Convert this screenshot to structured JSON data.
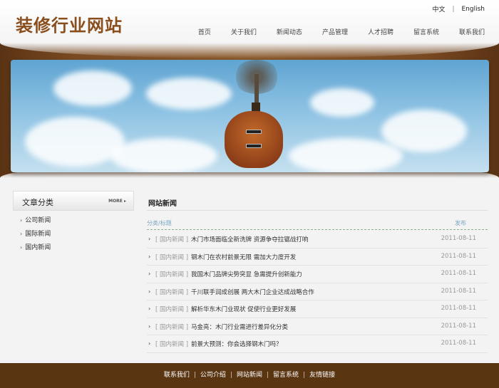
{
  "header": {
    "logo": "装修行业网站",
    "lang": [
      "中文",
      "English"
    ],
    "lang_sep": "|",
    "nav": [
      "首页",
      "关于我们",
      "新闻动态",
      "产品管理",
      "人才招聘",
      "留言系统",
      "联系我们"
    ]
  },
  "sidebar": {
    "title": "文章分类",
    "more": "MORE ▸",
    "items": [
      "公司新闻",
      "国际新闻",
      "国内新闻"
    ]
  },
  "main": {
    "title": "网站新闻",
    "col_category": "分类/标题",
    "col_date": "发布",
    "rows": [
      {
        "cat": "[ 国内新闻 ]",
        "title": "木门市场面临全新洗牌 资源争夺拉锯战打响",
        "date": "2011-08-11"
      },
      {
        "cat": "[ 国内新闻 ]",
        "title": "钢木门在农村前景无限 需加大力度开发",
        "date": "2011-08-11"
      },
      {
        "cat": "[ 国内新闻 ]",
        "title": "我国木门品牌尖势突显 急需提升创新能力",
        "date": "2011-08-11"
      },
      {
        "cat": "[ 国内新闻 ]",
        "title": "千川联手润成创展 两大木门企业达成战略合作",
        "date": "2011-08-11"
      },
      {
        "cat": "[ 国内新闻 ]",
        "title": "解析华东木门业现状 促使行业更好发展",
        "date": "2011-08-11"
      },
      {
        "cat": "[ 国内新闻 ]",
        "title": "马金亮：木门行业需进行差异化分类",
        "date": "2011-08-11"
      },
      {
        "cat": "[ 国内新闻 ]",
        "title": "前景大预测：你会选择钢木门吗？",
        "date": "2011-08-11"
      }
    ]
  },
  "footer": {
    "links": [
      "联系我们",
      "公司介绍",
      "网站新闻",
      "留言系统",
      "友情链接"
    ],
    "sep": "|"
  }
}
